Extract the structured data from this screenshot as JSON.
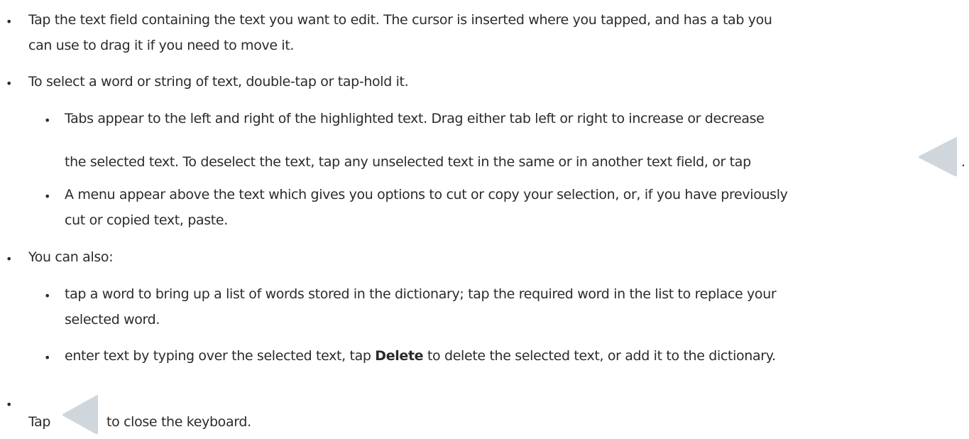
{
  "items": [
    {
      "line1": "Tap the text field containing the text you want to edit. The cursor is inserted where you tapped, and has a tab you",
      "line2": "can use to drag it if you need to move it."
    },
    {
      "line1": "To select a word or string of text, double-tap or tap-hold it.",
      "subitems": [
        {
          "line1": "Tabs appear to the left and right of the highlighted text. Drag either tab left or right to increase or decrease",
          "line2": "the selected text. To deselect the text, tap any unselected text in the same or in another text field, or tap",
          "line2_end": ".",
          "icon": "back-triangle-icon"
        },
        {
          "line1": "A menu appear above the text which gives you options to cut or copy your selection, or, if you have previously",
          "line2": "cut or copied text, paste."
        }
      ]
    },
    {
      "line1": "You can also:",
      "subitems": [
        {
          "line1": "tap a word to bring up a list of words stored in the dictionary; tap the required word in the list to replace your",
          "line2": "selected word."
        },
        {
          "line1_pre": "enter text by typing over the selected text, tap",
          "line1_bold": "Delete",
          "line1_post": "to delete the selected text, or add it to the dictionary."
        }
      ]
    },
    {
      "line1_pre": "Tap",
      "line1_post": "to close the keyboard.",
      "icon": "back-triangle-icon"
    }
  ],
  "bullet_char": "•",
  "icon_color": "#cfd6dc"
}
